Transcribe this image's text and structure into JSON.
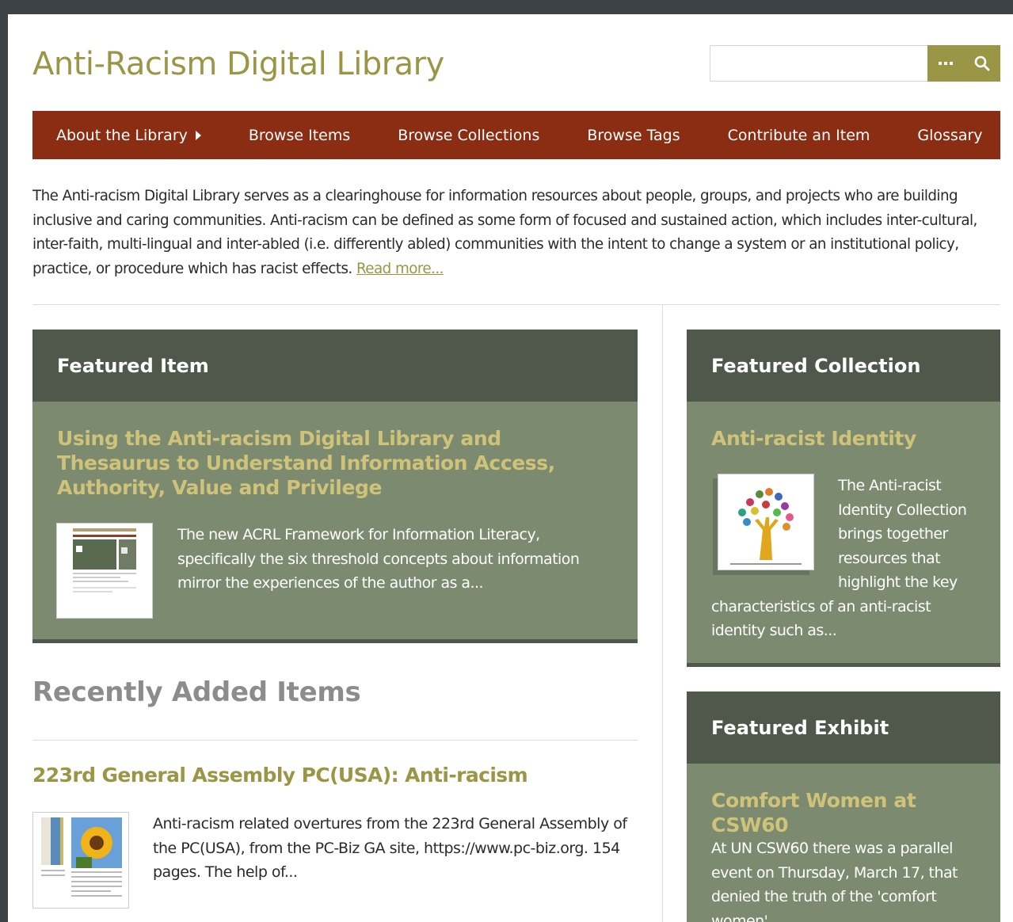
{
  "site": {
    "title": "Anti-Racism Digital Library"
  },
  "search": {
    "value": "",
    "options_icon": "ellipsis-icon",
    "submit_icon": "search-icon"
  },
  "colors": {
    "brand": "#9a9645",
    "nav": "#8b2d13",
    "panel_head": "#4f584b",
    "panel_body": "#7c8a70",
    "panel_title": "#cfc37a"
  },
  "nav": {
    "items": [
      {
        "label": "About the Library"
      },
      {
        "label": "Browse Items"
      },
      {
        "label": "Browse Collections"
      },
      {
        "label": "Browse Tags"
      },
      {
        "label": "Contribute an Item"
      },
      {
        "label": "Glossary"
      }
    ]
  },
  "intro": {
    "text": "The Anti-racism Digital Library serves as a clearinghouse for information resources about people, groups, and projects who are building inclusive and caring communities. Anti-racism can be defined as some form of focused and sustained action, which includes inter-cultural, inter-faith, multi-lingual and inter-abled (i.e. differently abled) communities with the intent to change a system or an institutional policy, practice, or procedure which has racist effects.",
    "read_more": "Read more..."
  },
  "featured_item": {
    "heading": "Featured Item",
    "title": "Using the Anti-racism Digital Library and Thesaurus to Understand Information Access, Authority, Value and Privilege",
    "description": "The new ACRL Framework for Information Literacy, specifically the six threshold concepts about information mirror the experiences of the author as a..."
  },
  "featured_collection": {
    "heading": "Featured Collection",
    "title": "Anti-racist Identity",
    "description": "The Anti-racist Identity Collection brings together resources that highlight the key characteristics of an anti-racist identity such as..."
  },
  "featured_exhibit": {
    "heading": "Featured Exhibit",
    "title": "Comfort Women at CSW60",
    "description": "At UN CSW60 there was a parallel event on Thursday, March 17, that denied the truth of the 'comfort women'."
  },
  "recent": {
    "heading": "Recently Added Items",
    "items": [
      {
        "title": "223rd General Assembly PC(USA): Anti-racism",
        "description": "Anti-racism related overtures from the 223rd General Assembly of the PC(USA), from the PC-Biz GA site, https://www.pc-biz.org. 154 pages. The help of..."
      }
    ]
  }
}
